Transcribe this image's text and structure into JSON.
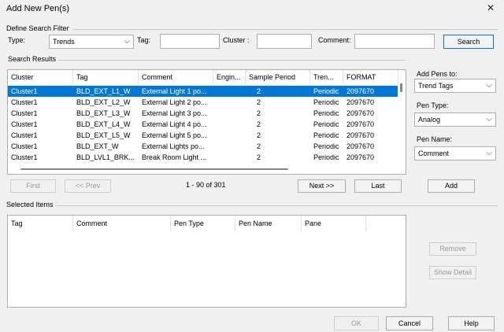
{
  "window": {
    "title": "Add New Pen(s)",
    "close_glyph": "✕"
  },
  "filter": {
    "group_label": "Define Search Filter",
    "type_label": "Type:",
    "type_value": "Trends",
    "tag_label": "Tag:",
    "tag_value": "",
    "cluster_label": "Cluster :",
    "cluster_value": "",
    "comment_label": "Comment:",
    "comment_value": "",
    "search_button": "Search"
  },
  "results": {
    "group_label": "Search Results",
    "columns": [
      "Cluster",
      "Tag",
      "Comment",
      "Engin...",
      "Sample Period",
      "Tren...",
      "FORMAT"
    ],
    "rows": [
      [
        "Cluster1",
        "BLD_EXT_L1_W",
        "External Light 1 po...",
        "",
        "2",
        "Periodic",
        "2097670"
      ],
      [
        "Cluster1",
        "BLD_EXT_L2_W",
        "External Light 2 po...",
        "",
        "2",
        "Periodic",
        "2097670"
      ],
      [
        "Cluster1",
        "BLD_EXT_L3_W",
        "External Light 3 po...",
        "",
        "2",
        "Periodic",
        "2097670"
      ],
      [
        "Cluster1",
        "BLD_EXT_L4_W",
        "External Light 4 po...",
        "",
        "2",
        "Periodic",
        "2097670"
      ],
      [
        "Cluster1",
        "BLD_EXT_L5_W",
        "External Light 5 po...",
        "",
        "2",
        "Periodic",
        "2097670"
      ],
      [
        "Cluster1",
        "BLD_EXT_W",
        "External Lights po...",
        "",
        "2",
        "Periodic",
        "2097670"
      ],
      [
        "Cluster1",
        "BLD_LVL1_BRK...",
        "Break Room Light ...",
        "",
        "2",
        "Periodic",
        "2097670"
      ]
    ],
    "selected_row": 0,
    "first_button": "First",
    "prev_button": "<< Prev",
    "range_text": "1 - 90 of 301",
    "next_button": "Next >>",
    "last_button": "Last"
  },
  "right_panel": {
    "add_pens_to_label": "Add Pens to:",
    "add_pens_to_value": "Trend Tags",
    "pen_type_label": "Pen Type:",
    "pen_type_value": "Analog",
    "pen_name_label": "Pen Name:",
    "pen_name_value": "Comment",
    "add_button": "Add",
    "caret_glyph": "⌵"
  },
  "selected": {
    "group_label": "Selected Items",
    "columns": [
      "Tag",
      "Comment",
      "Pen Type",
      "Pen Name",
      "Pane"
    ],
    "remove_button": "Remove",
    "show_detail_button": "Show Detail"
  },
  "footer": {
    "ok_button": "OK",
    "cancel_button": "Cancel",
    "help_button": "Help"
  }
}
